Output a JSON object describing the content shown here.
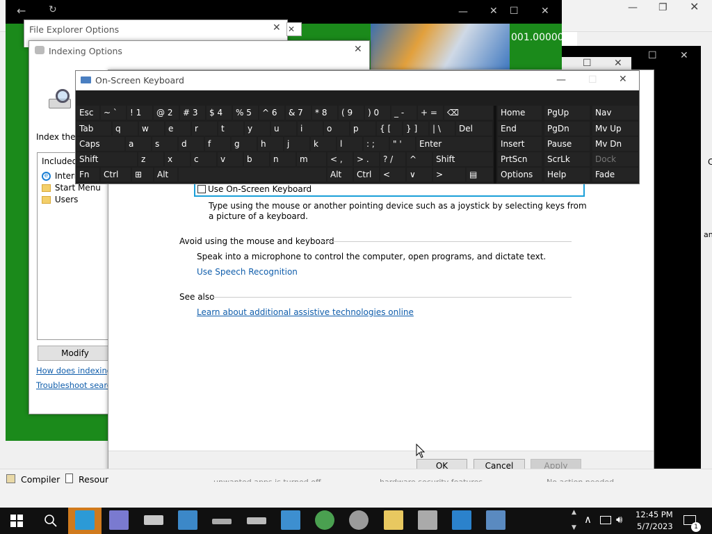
{
  "bg_window": {
    "value_readout": "001.00000"
  },
  "file_explorer_options": {
    "title": "File Explorer Options"
  },
  "indexing_options": {
    "title": "Indexing Options",
    "index_these_label": "Index these",
    "included_label": "Included L",
    "locations": [
      "Interne",
      "Start Menu",
      "Users"
    ],
    "modify_label": "Modify",
    "link_how": "How does indexing af",
    "link_troubleshoot": "Troubleshoot search a"
  },
  "osk": {
    "title": "On-Screen Keyboard",
    "rows": [
      [
        {
          "t": "Esc"
        },
        {
          "t": "~ `"
        },
        {
          "t": "! 1"
        },
        {
          "t": "@ 2"
        },
        {
          "t": "# 3"
        },
        {
          "t": "$ 4"
        },
        {
          "t": "% 5"
        },
        {
          "t": "^ 6"
        },
        {
          "t": "& 7"
        },
        {
          "t": "* 8"
        },
        {
          "t": "( 9"
        },
        {
          "t": ") 0"
        },
        {
          "t": "_ -"
        },
        {
          "t": "+ ="
        },
        {
          "t": "⌫"
        }
      ],
      [
        {
          "t": "Tab"
        },
        {
          "t": "q"
        },
        {
          "t": "w"
        },
        {
          "t": "e"
        },
        {
          "t": "r"
        },
        {
          "t": "t"
        },
        {
          "t": "y"
        },
        {
          "t": "u"
        },
        {
          "t": "i"
        },
        {
          "t": "o"
        },
        {
          "t": "p"
        },
        {
          "t": "{ ["
        },
        {
          "t": "} ]"
        },
        {
          "t": "| \\"
        },
        {
          "t": "Del"
        }
      ],
      [
        {
          "t": "Caps"
        },
        {
          "t": "a"
        },
        {
          "t": "s"
        },
        {
          "t": "d"
        },
        {
          "t": "f"
        },
        {
          "t": "g"
        },
        {
          "t": "h"
        },
        {
          "t": "j"
        },
        {
          "t": "k"
        },
        {
          "t": "l"
        },
        {
          "t": ": ;"
        },
        {
          "t": "\" '"
        },
        {
          "t": "Enter"
        }
      ],
      [
        {
          "t": "Shift"
        },
        {
          "t": "z"
        },
        {
          "t": "x"
        },
        {
          "t": "c"
        },
        {
          "t": "v"
        },
        {
          "t": "b"
        },
        {
          "t": "n"
        },
        {
          "t": "m"
        },
        {
          "t": "< ,"
        },
        {
          "t": "> ."
        },
        {
          "t": "? /"
        },
        {
          "t": "^"
        },
        {
          "t": "Shift"
        }
      ],
      [
        {
          "t": "Fn"
        },
        {
          "t": "Ctrl"
        },
        {
          "t": "⊞"
        },
        {
          "t": "Alt"
        },
        {
          "t": ""
        },
        {
          "t": "Alt"
        },
        {
          "t": "Ctrl"
        },
        {
          "t": "<"
        },
        {
          "t": "∨"
        },
        {
          "t": ">"
        },
        {
          "t": "▤"
        }
      ]
    ],
    "nav": [
      [
        "Home",
        "PgUp",
        "Nav"
      ],
      [
        "End",
        "PgDn",
        "Mv Up"
      ],
      [
        "Insert",
        "Pause",
        "Mv Dn"
      ],
      [
        "PrtScn",
        "ScrLk",
        "Dock"
      ],
      [
        "Options",
        "Help",
        "Fade"
      ]
    ]
  },
  "ease": {
    "checkbox_label": "Use On-Screen Keyboard",
    "osk_desc": "Type using the mouse or another pointing device such as a joystick by selecting keys from a picture of a keyboard.",
    "avoid_heading": "Avoid using the mouse and keyboard",
    "speech_desc": "Speak into a microphone to control the computer, open programs, and dictate text.",
    "speech_link": "Use Speech Recognition",
    "see_also": "See also",
    "learn_link": "Learn about additional assistive technologies online",
    "ok": "OK",
    "cancel": "Cancel",
    "apply": "Apply"
  },
  "bottom_strip": {
    "compiler": "Compiler",
    "resource": "Resour",
    "snippet1": "unwanted apps is turned off.",
    "snippet2": "hardware security features",
    "snippet3": "No action needed"
  },
  "right_edge": {
    "text1": "C",
    "text2": "ang"
  },
  "taskbar": {
    "time": "12:45 PM",
    "date": "5/7/2023",
    "notify_count": "1"
  },
  "colors": {
    "green": "#1b8a1b",
    "osk_bg": "#1e1e1e",
    "accent": "#1a9fd8",
    "taskbar": "#101010"
  }
}
